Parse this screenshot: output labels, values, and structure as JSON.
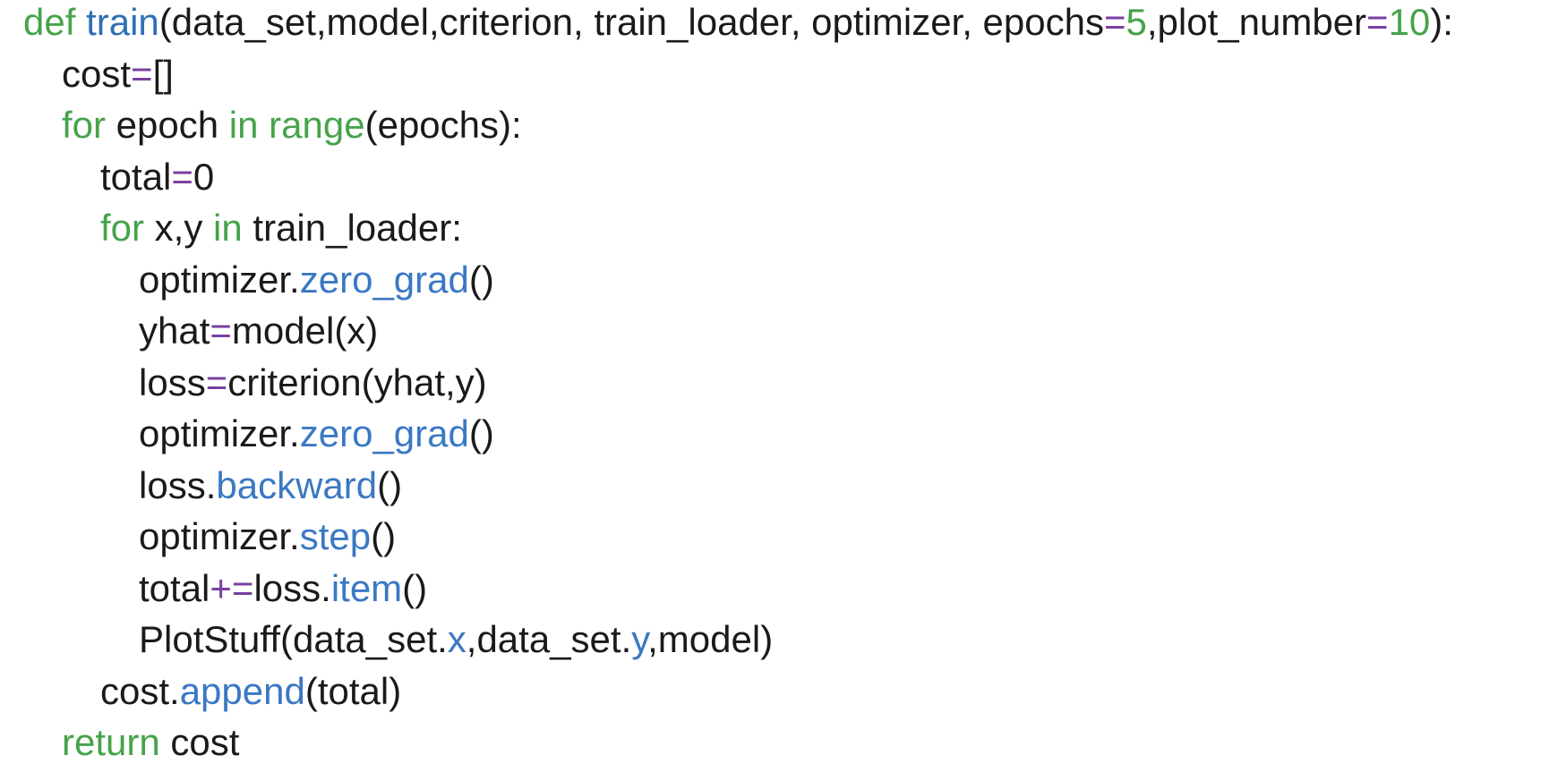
{
  "colors": {
    "keyword": "#46a34a",
    "function_name": "#2f6fb5",
    "method": "#3a78c3",
    "operator": "#7a3fa0",
    "number": "#46a34a",
    "plain": "#1a1a1a"
  },
  "code": {
    "lines": [
      {
        "indent": 0,
        "tokens": [
          {
            "text": "def",
            "kind": "keyword"
          },
          {
            "text": " ",
            "kind": "plain"
          },
          {
            "text": "train",
            "kind": "function_name"
          },
          {
            "text": "(data_set,model,criterion, train_loader, optimizer, epochs",
            "kind": "plain"
          },
          {
            "text": "=",
            "kind": "operator"
          },
          {
            "text": "5",
            "kind": "number"
          },
          {
            "text": ",plot_number",
            "kind": "plain"
          },
          {
            "text": "=",
            "kind": "operator"
          },
          {
            "text": "10",
            "kind": "number"
          },
          {
            "text": "):",
            "kind": "plain"
          }
        ]
      },
      {
        "indent": 1,
        "tokens": [
          {
            "text": "cost",
            "kind": "plain"
          },
          {
            "text": "=",
            "kind": "operator"
          },
          {
            "text": "[]",
            "kind": "plain"
          }
        ]
      },
      {
        "indent": 1,
        "tokens": [
          {
            "text": "for",
            "kind": "keyword"
          },
          {
            "text": " epoch ",
            "kind": "plain"
          },
          {
            "text": "in",
            "kind": "keyword"
          },
          {
            "text": " ",
            "kind": "plain"
          },
          {
            "text": "range",
            "kind": "number"
          },
          {
            "text": "(epochs):",
            "kind": "plain"
          }
        ]
      },
      {
        "indent": 2,
        "tokens": [
          {
            "text": "total",
            "kind": "plain"
          },
          {
            "text": "=",
            "kind": "operator"
          },
          {
            "text": "0",
            "kind": "plain"
          }
        ]
      },
      {
        "indent": 2,
        "tokens": [
          {
            "text": "for",
            "kind": "keyword"
          },
          {
            "text": " x,y ",
            "kind": "plain"
          },
          {
            "text": "in",
            "kind": "keyword"
          },
          {
            "text": " train_loader:",
            "kind": "plain"
          }
        ]
      },
      {
        "indent": 3,
        "tokens": [
          {
            "text": "optimizer.",
            "kind": "plain"
          },
          {
            "text": "zero_grad",
            "kind": "method"
          },
          {
            "text": "()",
            "kind": "plain"
          }
        ]
      },
      {
        "indent": 3,
        "tokens": [
          {
            "text": "yhat",
            "kind": "plain"
          },
          {
            "text": "=",
            "kind": "operator"
          },
          {
            "text": "model(x)",
            "kind": "plain"
          }
        ]
      },
      {
        "indent": 3,
        "tokens": [
          {
            "text": "loss",
            "kind": "plain"
          },
          {
            "text": "=",
            "kind": "operator"
          },
          {
            "text": "criterion(yhat,y)",
            "kind": "plain"
          }
        ]
      },
      {
        "indent": 3,
        "tokens": [
          {
            "text": "optimizer.",
            "kind": "plain"
          },
          {
            "text": "zero_grad",
            "kind": "method"
          },
          {
            "text": "()",
            "kind": "plain"
          }
        ]
      },
      {
        "indent": 3,
        "tokens": [
          {
            "text": "loss.",
            "kind": "plain"
          },
          {
            "text": "backward",
            "kind": "method"
          },
          {
            "text": "()",
            "kind": "plain"
          }
        ]
      },
      {
        "indent": 3,
        "tokens": [
          {
            "text": "optimizer.",
            "kind": "plain"
          },
          {
            "text": "step",
            "kind": "method"
          },
          {
            "text": "()",
            "kind": "plain"
          }
        ]
      },
      {
        "indent": 3,
        "tokens": [
          {
            "text": "total",
            "kind": "plain"
          },
          {
            "text": "+=",
            "kind": "operator"
          },
          {
            "text": "loss.",
            "kind": "plain"
          },
          {
            "text": "item",
            "kind": "method"
          },
          {
            "text": "()",
            "kind": "plain"
          }
        ]
      },
      {
        "indent": 3,
        "tokens": [
          {
            "text": "PlotStuff(data_set.",
            "kind": "plain"
          },
          {
            "text": "x",
            "kind": "method"
          },
          {
            "text": ",data_set.",
            "kind": "plain"
          },
          {
            "text": "y",
            "kind": "method"
          },
          {
            "text": ",model)",
            "kind": "plain"
          }
        ]
      },
      {
        "indent": 2,
        "tokens": [
          {
            "text": "cost.",
            "kind": "plain"
          },
          {
            "text": "append",
            "kind": "method"
          },
          {
            "text": "(total)",
            "kind": "plain"
          }
        ]
      },
      {
        "indent": 1,
        "tokens": [
          {
            "text": "return",
            "kind": "keyword"
          },
          {
            "text": " cost",
            "kind": "plain"
          }
        ]
      }
    ]
  }
}
